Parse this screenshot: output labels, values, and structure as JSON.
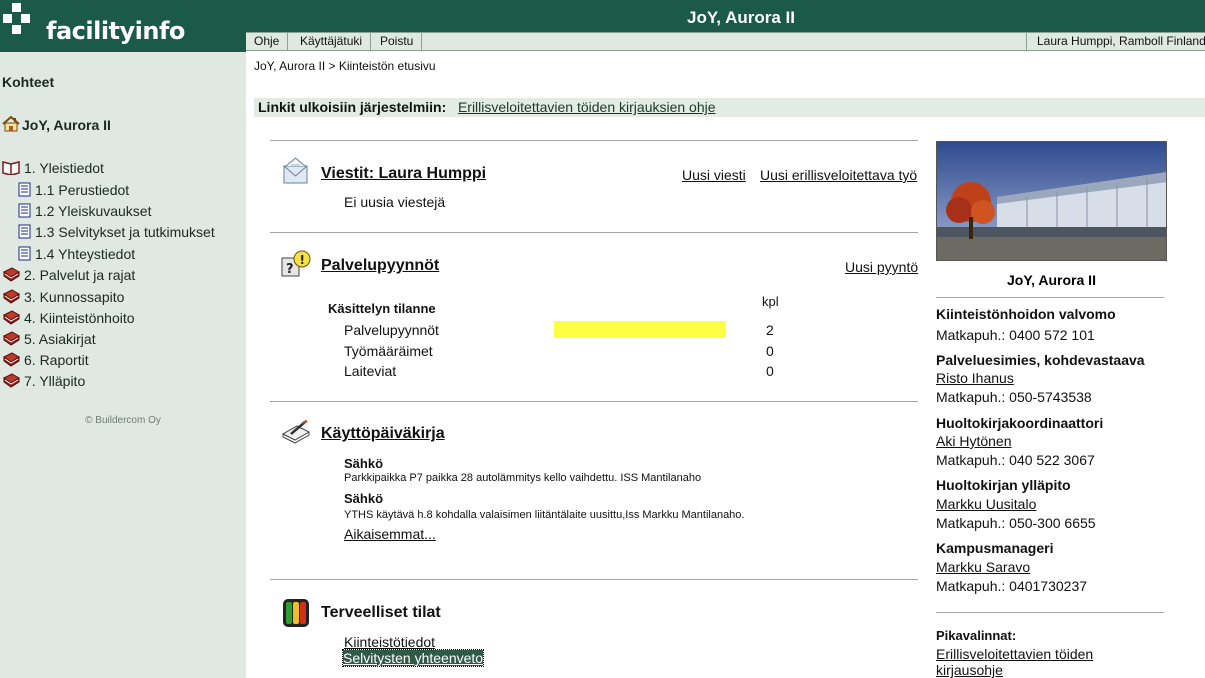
{
  "header": {
    "logo_text": "facilityinfo",
    "title": "JoY, Aurora II",
    "menu": [
      "Ohje",
      "Käyttäjätuki",
      "Poistu"
    ],
    "user": "Laura Humppi, Ramboll Finland"
  },
  "sidebar": {
    "heading": "Kohteet",
    "home": "JoY, Aurora II",
    "items": [
      {
        "label": "1. Yleistiedot",
        "icon": "open-book-icon"
      },
      {
        "label": "1.1 Perustiedot",
        "icon": "document-icon"
      },
      {
        "label": "1.2 Yleiskuvaukset",
        "icon": "document-icon"
      },
      {
        "label": "1.3 Selvitykset ja tutkimukset",
        "icon": "document-icon"
      },
      {
        "label": "1.4 Yhteystiedot",
        "icon": "document-icon"
      },
      {
        "label": "2. Palvelut ja rajat",
        "icon": "closed-book-icon"
      },
      {
        "label": "3. Kunnossapito",
        "icon": "closed-book-icon"
      },
      {
        "label": "4. Kiinteistönhoito",
        "icon": "closed-book-icon"
      },
      {
        "label": "5. Asiakirjat",
        "icon": "closed-book-icon"
      },
      {
        "label": "6. Raportit",
        "icon": "closed-book-icon"
      },
      {
        "label": "7. Ylläpito",
        "icon": "closed-book-icon"
      }
    ],
    "copyright": "© Buildercom Oy"
  },
  "breadcrumb": "JoY, Aurora II > Kiinteistön etusivu",
  "external_links": {
    "label": "Linkit ulkoisiin järjestelmiin:",
    "link": "Erillisveloitettavien töiden kirjauksien ohje"
  },
  "messages": {
    "title": "Viestit: Laura Humppi",
    "new_message": "Uusi viesti",
    "new_extra_work": "Uusi erillisveloitettava työ",
    "empty": "Ei uusia viestejä"
  },
  "service_requests": {
    "title": "Palvelupyynnöt",
    "new_request": "Uusi pyyntö",
    "col_status": "Käsittelyn tilanne",
    "col_count": "kpl",
    "bar_color": "#ffff44",
    "rows": [
      {
        "label": "Palvelupyynnöt",
        "count": "2",
        "bar_fraction": 1.0
      },
      {
        "label": "Työmääräimet",
        "count": "0",
        "bar_fraction": 0
      },
      {
        "label": "Laiteviat",
        "count": "0",
        "bar_fraction": 0
      }
    ]
  },
  "diary": {
    "title": "Käyttöpäiväkirja",
    "entries": [
      {
        "category": "Sähkö",
        "text": "Parkkipaikka P7 paikka 28 autolämmitys kello vaihdettu. ISS Mantilanaho"
      },
      {
        "category": "Sähkö",
        "text": "YTHS käytävä h.8 kohdalla valaisimen liitäntälaite uusittu,Iss Markku Mantilanaho."
      }
    ],
    "more": "Aikaisemmat..."
  },
  "healthy": {
    "title": "Terveelliset tilat",
    "links": [
      "Kiinteistötiedot",
      "Selvitysten yhteenveto"
    ]
  },
  "right": {
    "building": "JoY, Aurora II",
    "contacts": [
      {
        "role": "Kiinteistönhoidon valvomo",
        "name": "",
        "phone": "Matkapuh.: 0400 572 101"
      },
      {
        "role": "Palveluesimies, kohdevastaava",
        "name": "Risto Ihanus",
        "phone": "Matkapuh.: 050-5743538"
      },
      {
        "role": "Huoltokirjakoordinaattori",
        "name": "Aki Hytönen",
        "phone": "Matkapuh.: 040 522 3067"
      },
      {
        "role": "Huoltokirjan ylläpito",
        "name": "Markku Uusitalo",
        "phone": "Matkapuh.: 050-300 6655"
      },
      {
        "role": "Kampusmanageri",
        "name": "Markku Saravo",
        "phone": "Matkapuh.: 0401730237"
      }
    ],
    "quicklinks_label": "Pikavalinnat:",
    "quicklink_1": "Erillisveloitettavien töiden",
    "quicklink_2": "kirjausohje"
  }
}
